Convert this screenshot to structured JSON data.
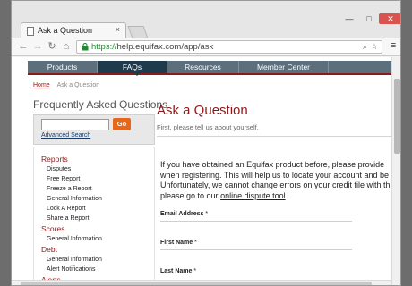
{
  "browser": {
    "tab_title": "Ask a Question",
    "tab_close": "×",
    "url_scheme": "https://",
    "url_rest": "help.equifax.com/app/ask",
    "icons": {
      "back": "arrow-left-icon",
      "forward": "arrow-right-icon",
      "reload": "reload-icon",
      "home": "home-icon",
      "lock": "lock-icon",
      "zoom": "zoom-icon",
      "star": "star-icon",
      "menu": "hamburger-menu-icon"
    }
  },
  "nav": {
    "items": [
      {
        "label": "Products"
      },
      {
        "label": "FAQs"
      },
      {
        "label": "Resources"
      },
      {
        "label": "Member Center"
      }
    ],
    "active_index": 1
  },
  "breadcrumb": {
    "home": "Home",
    "current": "Ask a Question"
  },
  "sidebar": {
    "heading": "Frequently Asked Questions",
    "search_value": "",
    "go_label": "Go",
    "advanced_search": "Advanced Search",
    "categories": [
      {
        "label": "Reports",
        "links": [
          "Disputes",
          "Free Report",
          "Freeze a Report",
          "General Information",
          "Lock A Report",
          "Share a Report"
        ]
      },
      {
        "label": "Scores",
        "links": [
          "General Information"
        ]
      },
      {
        "label": "Debt",
        "links": [
          "General Information",
          "Alert Notifications"
        ]
      },
      {
        "label": "Alerts",
        "links": []
      }
    ]
  },
  "main": {
    "title": "Ask a Question",
    "subtitle": "First, please tell us about yourself.",
    "intro_lines": [
      "If you have obtained an Equifax product before, please provide",
      "when registering. This will help us to locate your account and be",
      "Unfortunately, we cannot change errors on your credit file with th"
    ],
    "intro_last_prefix": "please go to our ",
    "intro_link": "online dispute tool",
    "intro_last_suffix": ".",
    "fields": [
      {
        "label": "Email Address",
        "required": "*"
      },
      {
        "label": "First Name",
        "required": "*"
      },
      {
        "label": "Last Name",
        "required": "*"
      }
    ]
  },
  "colors": {
    "brand_red": "#8b1a1a",
    "nav_bg": "#5b6f7c",
    "nav_active": "#1e3a4d",
    "go_button": "#e8661a"
  }
}
